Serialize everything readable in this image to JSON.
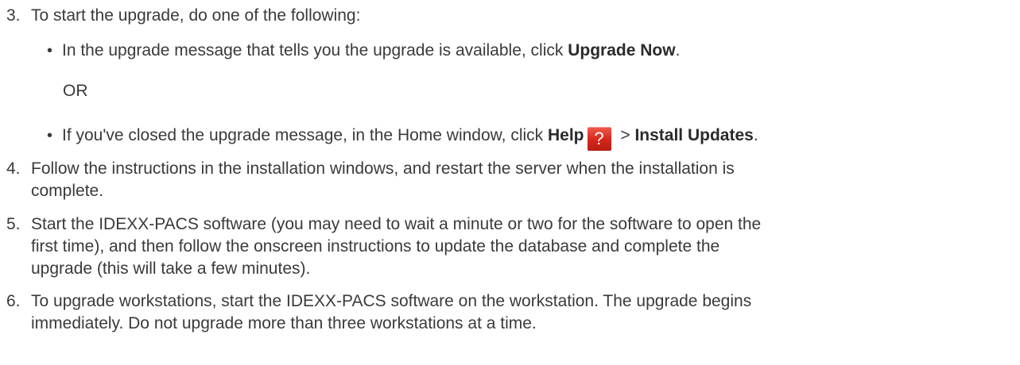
{
  "steps": [
    {
      "number": "3.",
      "text": "To start the upgrade, do one of the following:",
      "bullets": [
        {
          "pre": "In the upgrade message that tells you the upgrade is available, click ",
          "bold": "Upgrade Now",
          "post": "."
        },
        {
          "or": "OR"
        },
        {
          "pre": "If you've closed the upgrade message, in the Home window, click ",
          "bold1": "Help",
          "icon": "help-question-icon",
          "icon_glyph": "?",
          "mid": " > ",
          "bold2": "Install Updates",
          "post": "."
        }
      ]
    },
    {
      "number": "4.",
      "lines": [
        "Follow the instructions in the installation windows, and restart the server when the installation is",
        "complete."
      ]
    },
    {
      "number": "5.",
      "lines": [
        "Start the IDEXX-PACS software (you may need to wait a minute or two for the software to open the",
        "first time), and then follow the onscreen instructions to update the database and complete the",
        "upgrade (this will take a few minutes)."
      ]
    },
    {
      "number": "6.",
      "lines": [
        "To upgrade workstations, start the IDEXX-PACS software on the workstation. The upgrade begins",
        "immediately. Do not upgrade more than three workstations at a time."
      ]
    }
  ],
  "colors": {
    "text": "#3a3a3a",
    "icon_red": "#d7261b"
  }
}
